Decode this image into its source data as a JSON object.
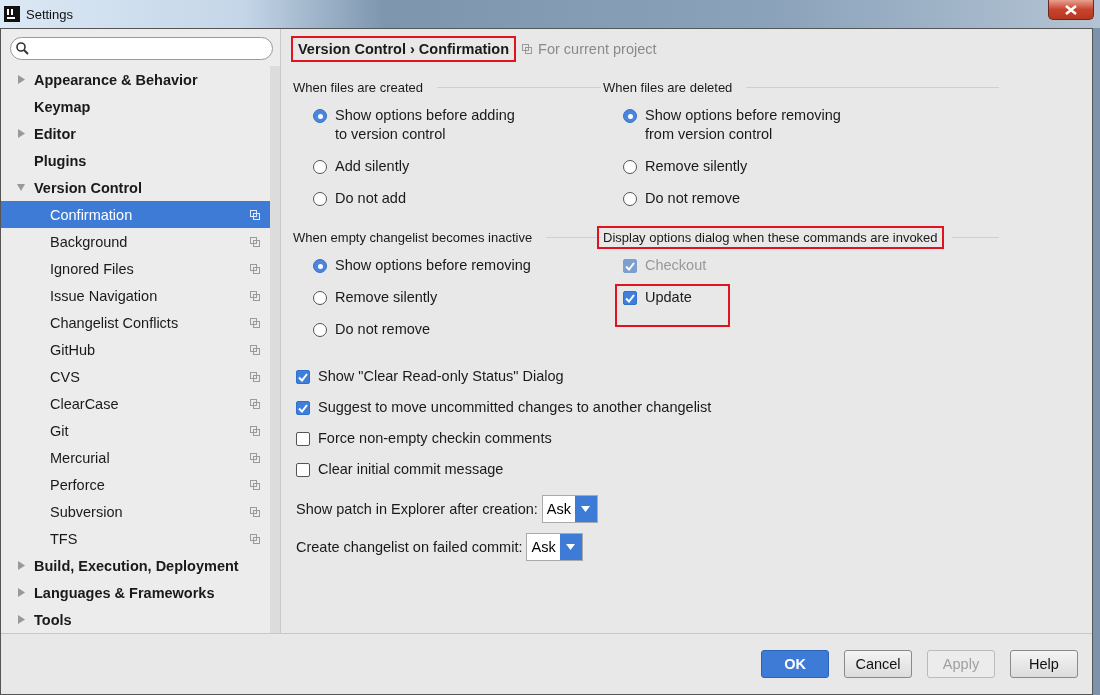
{
  "window": {
    "title": "Settings"
  },
  "sidebar": {
    "items": [
      {
        "label": "Appearance & Behavior",
        "kind": "folder",
        "expanded": false,
        "selected": false
      },
      {
        "label": "Keymap",
        "kind": "leaf",
        "selected": false
      },
      {
        "label": "Editor",
        "kind": "folder",
        "expanded": false,
        "selected": false
      },
      {
        "label": "Plugins",
        "kind": "leaf",
        "selected": false
      },
      {
        "label": "Version Control",
        "kind": "folder",
        "expanded": true,
        "selected": false,
        "children": [
          {
            "label": "Confirmation",
            "selected": true
          },
          {
            "label": "Background",
            "selected": false
          },
          {
            "label": "Ignored Files",
            "selected": false
          },
          {
            "label": "Issue Navigation",
            "selected": false
          },
          {
            "label": "Changelist Conflicts",
            "selected": false
          },
          {
            "label": "GitHub",
            "selected": false
          },
          {
            "label": "CVS",
            "selected": false
          },
          {
            "label": "ClearCase",
            "selected": false
          },
          {
            "label": "Git",
            "selected": false
          },
          {
            "label": "Mercurial",
            "selected": false
          },
          {
            "label": "Perforce",
            "selected": false
          },
          {
            "label": "Subversion",
            "selected": false
          },
          {
            "label": "TFS",
            "selected": false
          }
        ]
      },
      {
        "label": "Build, Execution, Deployment",
        "kind": "folder",
        "expanded": false,
        "selected": false
      },
      {
        "label": "Languages & Frameworks",
        "kind": "folder",
        "expanded": false,
        "selected": false
      },
      {
        "label": "Tools",
        "kind": "folder",
        "expanded": false,
        "selected": false
      }
    ]
  },
  "header": {
    "breadcrumb": "Version Control › Confirmation",
    "highlighted": true,
    "scope": "For current project"
  },
  "groups": [
    {
      "title": "When files are created",
      "kind": "radio",
      "highlighted": false,
      "options": [
        {
          "label": "Show options before adding\nto version control",
          "selected": true
        },
        {
          "label": "Add silently",
          "selected": false
        },
        {
          "label": "Do not add",
          "selected": false
        }
      ]
    },
    {
      "title": "When files are deleted",
      "kind": "radio",
      "highlighted": false,
      "options": [
        {
          "label": "Show options before removing\nfrom version control",
          "selected": true
        },
        {
          "label": "Remove silently",
          "selected": false
        },
        {
          "label": "Do not remove",
          "selected": false
        }
      ]
    },
    {
      "title": "When empty changelist becomes inactive",
      "kind": "radio",
      "highlighted": false,
      "options": [
        {
          "label": "Show options before removing",
          "selected": true
        },
        {
          "label": "Remove silently",
          "selected": false
        },
        {
          "label": "Do not remove",
          "selected": false
        }
      ]
    },
    {
      "title": "Display options dialog when these commands are invoked",
      "kind": "checkbox",
      "highlighted": true,
      "options": [
        {
          "label": "Checkout",
          "checked": true,
          "disabled": true,
          "highlighted": false
        },
        {
          "label": "Update",
          "checked": true,
          "disabled": false,
          "highlighted": true
        }
      ]
    }
  ],
  "checkboxes": [
    {
      "label": "Show \"Clear Read-only Status\" Dialog",
      "checked": true
    },
    {
      "label": "Suggest to move uncommitted changes to another changelist",
      "checked": true
    },
    {
      "label": "Force non-empty checkin comments",
      "checked": false
    },
    {
      "label": "Clear initial commit message",
      "checked": false
    }
  ],
  "dropdowns": [
    {
      "label": "Show patch in Explorer after creation:",
      "value": "Ask"
    },
    {
      "label": "Create changelist on failed commit:",
      "value": "Ask"
    }
  ],
  "buttons": [
    {
      "label": "OK",
      "kind": "primary",
      "disabled": false
    },
    {
      "label": "Cancel",
      "kind": "normal",
      "disabled": false
    },
    {
      "label": "Apply",
      "kind": "normal",
      "disabled": true
    },
    {
      "label": "Help",
      "kind": "normal",
      "disabled": false
    }
  ]
}
